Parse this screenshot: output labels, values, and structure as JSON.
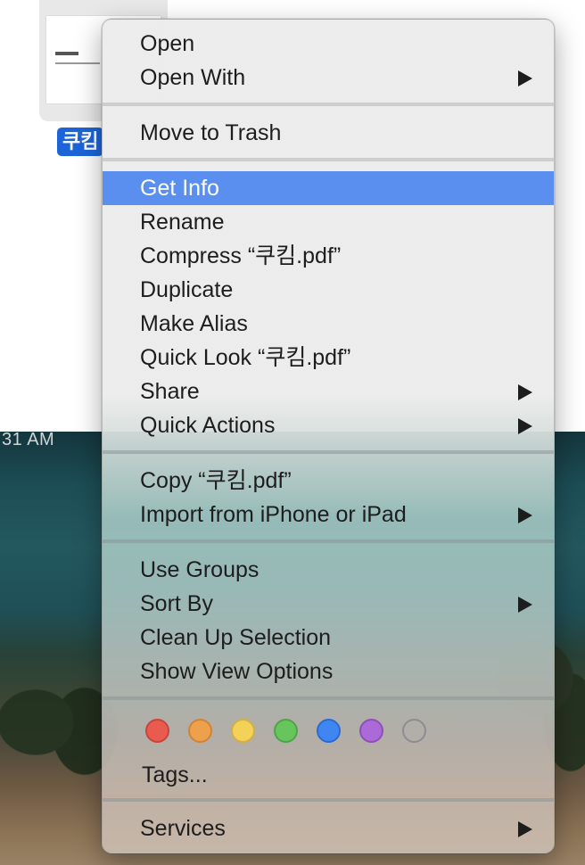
{
  "finder": {
    "file_label": "쿠킴",
    "menubar_time": "31 AM"
  },
  "context_menu": {
    "items": [
      {
        "label": "Open",
        "has_submenu": false
      },
      {
        "label": "Open With",
        "has_submenu": true
      },
      {
        "label": "Move to Trash",
        "has_submenu": false
      },
      {
        "label": "Get Info",
        "has_submenu": false,
        "highlighted": true
      },
      {
        "label": "Rename",
        "has_submenu": false
      },
      {
        "label": "Compress “쿠킴.pdf”",
        "has_submenu": false
      },
      {
        "label": "Duplicate",
        "has_submenu": false
      },
      {
        "label": "Make Alias",
        "has_submenu": false
      },
      {
        "label": "Quick Look “쿠킴.pdf”",
        "has_submenu": false
      },
      {
        "label": "Share",
        "has_submenu": true
      },
      {
        "label": "Quick Actions",
        "has_submenu": true
      },
      {
        "label": "Copy “쿠킴.pdf”",
        "has_submenu": false
      },
      {
        "label": "Import from iPhone or iPad",
        "has_submenu": true
      },
      {
        "label": "Use Groups",
        "has_submenu": false
      },
      {
        "label": "Sort By",
        "has_submenu": true
      },
      {
        "label": "Clean Up Selection",
        "has_submenu": false
      },
      {
        "label": "Show View Options",
        "has_submenu": false
      },
      {
        "label": "Services",
        "has_submenu": true
      }
    ],
    "tags_label": "Tags...",
    "tag_colors": [
      {
        "name": "red",
        "color": "#e95a4f",
        "border": "#c94439"
      },
      {
        "name": "orange",
        "color": "#efa04c",
        "border": "#d08433"
      },
      {
        "name": "yellow",
        "color": "#f3d259",
        "border": "#d3b040"
      },
      {
        "name": "green",
        "color": "#66c55c",
        "border": "#4ea545"
      },
      {
        "name": "blue",
        "color": "#3f86f3",
        "border": "#2a6bd1"
      },
      {
        "name": "purple",
        "color": "#ab6ad8",
        "border": "#8d4fb9"
      },
      {
        "name": "gray",
        "color": "transparent",
        "border": "#8a8e90"
      }
    ],
    "highlight_color": "#5a8ff0"
  }
}
